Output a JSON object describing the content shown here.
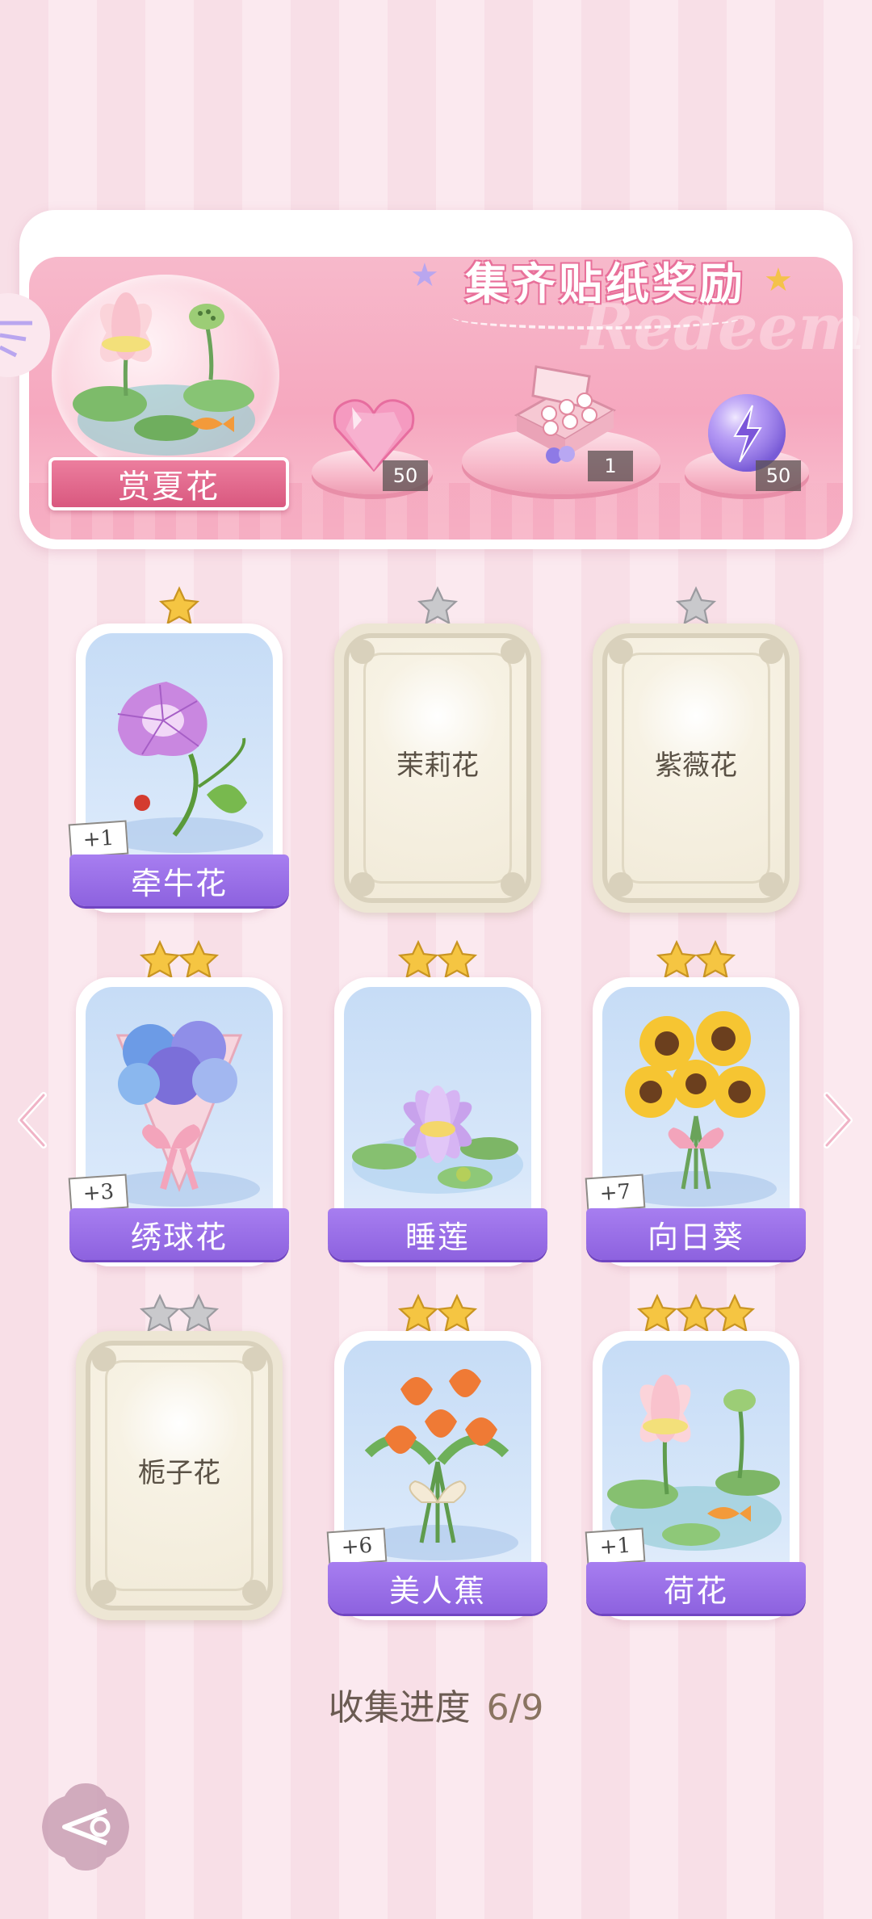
{
  "banner": {
    "title": "集齐贴纸奖励",
    "watermark": "Redeem",
    "collection_name": "赏夏花",
    "rewards": [
      {
        "icon": "pink-heart-gem-icon",
        "count": "50"
      },
      {
        "icon": "gift-box-icon",
        "count": "1"
      },
      {
        "icon": "purple-energy-orb-icon",
        "count": "50"
      }
    ]
  },
  "cards": [
    {
      "name": "牵牛花",
      "stars": 1,
      "collected": true,
      "bonus": "+1",
      "icon": "morning-glory-icon"
    },
    {
      "name": "茉莉花",
      "stars": 1,
      "collected": false,
      "bonus": "",
      "icon": ""
    },
    {
      "name": "紫薇花",
      "stars": 1,
      "collected": false,
      "bonus": "",
      "icon": ""
    },
    {
      "name": "绣球花",
      "stars": 2,
      "collected": true,
      "bonus": "+3",
      "icon": "hydrangea-bouquet-icon"
    },
    {
      "name": "睡莲",
      "stars": 2,
      "collected": true,
      "bonus": "",
      "icon": "water-lily-icon"
    },
    {
      "name": "向日葵",
      "stars": 2,
      "collected": true,
      "bonus": "+7",
      "icon": "sunflower-bouquet-icon"
    },
    {
      "name": "栀子花",
      "stars": 2,
      "collected": false,
      "bonus": "",
      "icon": ""
    },
    {
      "name": "美人蕉",
      "stars": 2,
      "collected": true,
      "bonus": "+6",
      "icon": "canna-bouquet-icon"
    },
    {
      "name": "荷花",
      "stars": 3,
      "collected": true,
      "bonus": "+1",
      "icon": "lotus-pond-icon"
    }
  ],
  "progress": {
    "label": "收集进度",
    "value": "6/9",
    "collected": 6,
    "total": 9
  },
  "colors": {
    "name_banner": "#9a6fe8",
    "gold_star": "#f5c542",
    "silver_star": "#c9c9cc",
    "banner_pink": "#f6a8bf"
  }
}
